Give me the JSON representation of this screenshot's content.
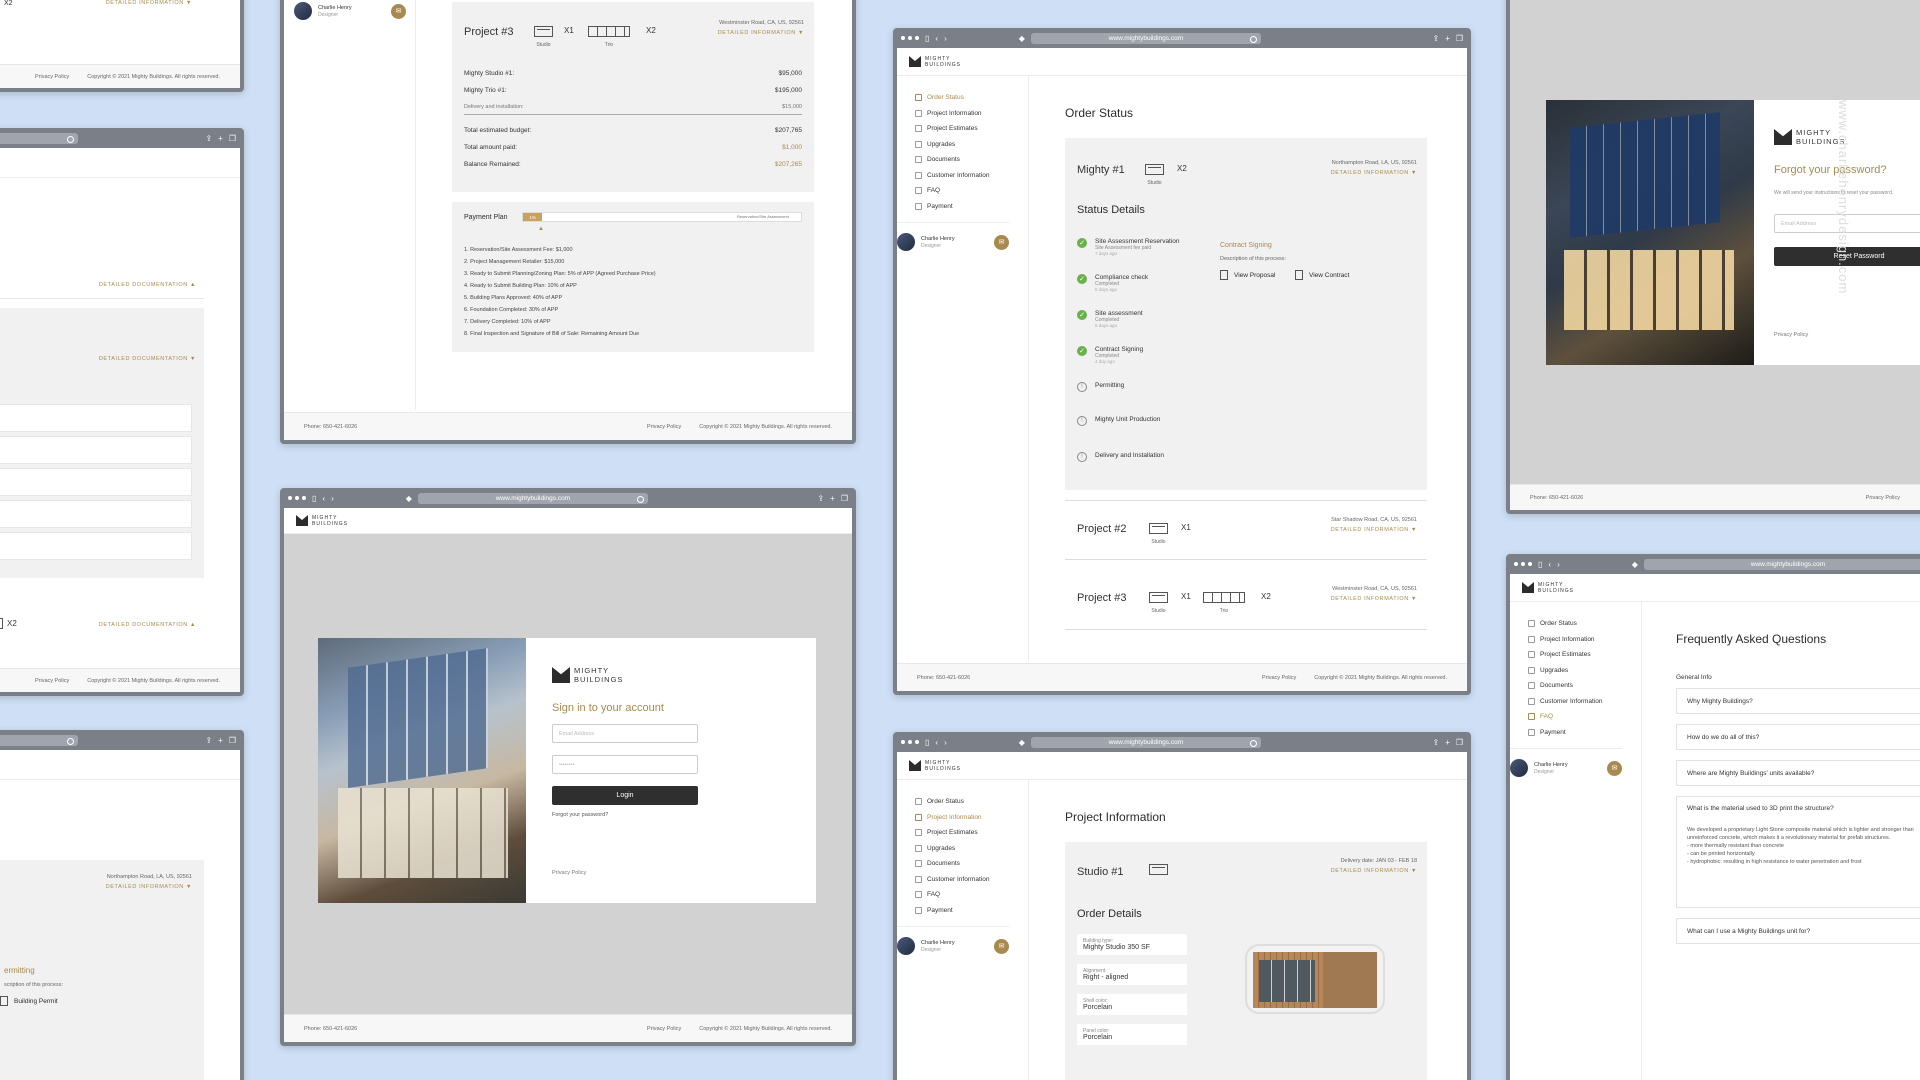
{
  "browser": {
    "url": "www.mightybuildings.com"
  },
  "brand": {
    "line1": "MIGHTY",
    "line2": "BUILDINGS"
  },
  "nav": [
    "Order Status",
    "Project Information",
    "Project Estimates",
    "Upgrades",
    "Documents",
    "Customer Information",
    "FAQ",
    "Payment"
  ],
  "user": {
    "name": "Charlie Henry",
    "role": "Designer"
  },
  "footer": {
    "phone": "Phone: 650-421-6026",
    "privacy": "Privacy Policy",
    "copyright": "Copyright © 2021 Mighty Buildings. All rights reserved."
  },
  "units": {
    "studio": "Studio",
    "trio": "Trio",
    "x1": "X1",
    "x2": "X2"
  },
  "detailed_info": "DETAILED INFORMATION",
  "detailed_doc": "DETAILED DOCUMENTATION",
  "estimate": {
    "project": "Project #3",
    "address": "Westminster Road, CA, US, 92561",
    "lines": [
      {
        "label": "Mighty Studio #1:",
        "value": "$95,000"
      },
      {
        "label": "Mighty Trio #1:",
        "value": "$195,000"
      },
      {
        "label": "Delivery and installation:",
        "value": "$15,000"
      }
    ],
    "totals": [
      {
        "label": "Total estimated budget:",
        "value": "$207,765"
      },
      {
        "label": "Total amount paid:",
        "value": "$1,000"
      },
      {
        "label": "Balance Remained:",
        "value": "$207,265"
      }
    ],
    "payment_plan": "Payment Plan",
    "plan_badge": "1%",
    "plan_end": "Reservation/Site Assessment",
    "plan_items": [
      "1. Reservation/Site Assessment Fee: $1,000",
      "2. Project Management Retailer: $15,000",
      "3. Ready to Submit Planning/Zoning Plan: 5% of APP (Agreed Purchase Price)",
      "4. Ready to Submit Building Plan: 10% of APP",
      "5. Building Plans Approved: 40% of APP",
      "6. Foundation Completed: 30% of APP",
      "7. Delivery Completed: 10% of APP",
      "8. Final Inspection and Signature of Bill of Sale: Remaining Amount Due"
    ]
  },
  "order_status": {
    "title": "Order Status",
    "project1": {
      "name": "Mighty #1",
      "address": "Northampton Road, LA, US, 92561"
    },
    "status_title": "Status Details",
    "steps": [
      {
        "title": "Site Assessment Reservation",
        "sub": "Site Assessment fee paid",
        "time": "7 days ago",
        "done": true
      },
      {
        "title": "Compliance check",
        "sub": "Completed",
        "time": "6 days ago",
        "done": true
      },
      {
        "title": "Site assessment",
        "sub": "Completed",
        "time": "5 days ago",
        "done": true
      },
      {
        "title": "Contract Signing",
        "sub": "Completed",
        "time": "4 day ago",
        "done": true
      },
      {
        "title": "Permitting",
        "sub": "",
        "time": "",
        "done": false
      },
      {
        "title": "Mighty Unit Production",
        "sub": "",
        "time": "",
        "done": false
      },
      {
        "title": "Delivery and Installation",
        "sub": "",
        "time": "",
        "done": false
      }
    ],
    "contract": {
      "title": "Contract Signing",
      "desc": "Description of this process:",
      "view_proposal": "View Proposal",
      "view_contract": "View Contract"
    },
    "project2": {
      "name": "Project #2",
      "address": "Star Shadow Road, CA, US, 92561"
    },
    "project3": {
      "name": "Project #3",
      "address": "Westminster Road, CA, US, 92561"
    }
  },
  "signin": {
    "title": "Sign in to your account",
    "email_ph": "Email Address",
    "password_ph": "••••••••",
    "login": "Login",
    "forgot": "Forgot your password?",
    "privacy": "Privacy Policy"
  },
  "forgot": {
    "title": "Forgot your password?",
    "desc": "We will send your instructions to reset your password.",
    "email_ph": "Email Address",
    "reset": "Reset Password",
    "privacy": "Privacy Policy",
    "watermark": "www.charliehenrydesign.com"
  },
  "faq": {
    "title": "Frequently Asked Questions",
    "section": "General Info",
    "items": [
      "Why Mighty Buildings?",
      "How do we do all of this?",
      "Where are Mighty Buildings' units available?",
      "What is the material used to 3D print the structure?",
      "What can I use a Mighty Buildings unit for?"
    ],
    "answer": "We developed a proprietary Light Stone composite material which is lighter and stronger than unreinforced concrete, which makes it a revolutionary material for prefab structures.",
    "bullets": [
      "- more thermally resistant than concrete",
      "- can be printed horizontally",
      "- hydrophobic: resulting in high resistance to water penetration and frost"
    ]
  },
  "project_info": {
    "title": "Project Information",
    "studio": "Studio #1",
    "delivery": "Delivery date: JAN 03 - FEB 18",
    "order_details": "Order Details",
    "fields": [
      {
        "label": "Building type:",
        "value": "Mighty Studio 350 SF"
      },
      {
        "label": "Alignment:",
        "value": "Right - aligned"
      },
      {
        "label": "Shell color:",
        "value": "Porcelain"
      },
      {
        "label": "Panel color:",
        "value": "Porcelain"
      }
    ]
  },
  "left_partial": {
    "address1": "Northampton Road, LA, US, 92561",
    "permitting": "ermitting",
    "desc": "scription of this process:",
    "building_permit": "Building Permit"
  }
}
